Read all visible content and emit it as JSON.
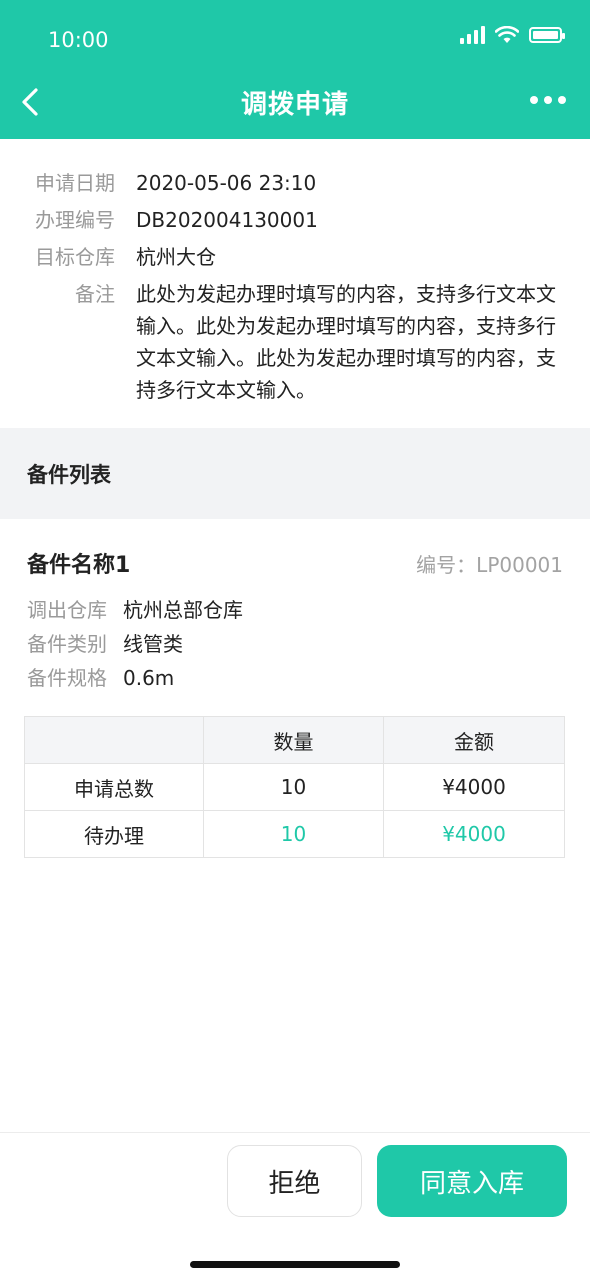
{
  "status_bar": {
    "time": "10:00"
  },
  "nav": {
    "title": "调拨申请"
  },
  "info": [
    {
      "label": "申请日期",
      "value": "2020-05-06 23:10"
    },
    {
      "label": "办理编号",
      "value": "DB202004130001"
    },
    {
      "label": "目标仓库",
      "value": "杭州大仓"
    },
    {
      "label": "备注",
      "value": "此处为发起办理时填写的内容，支持多行文本文输入。此处为发起办理时填写的内容，支持多行文本文输入。此处为发起办理时填写的内容，支持多行文本文输入。"
    }
  ],
  "section": {
    "title": "备件列表"
  },
  "part": {
    "name": "备件名称1",
    "code": "编号：LP00001",
    "rows": [
      {
        "label": "调出仓库",
        "value": "杭州总部仓库"
      },
      {
        "label": "备件类别",
        "value": "线管类"
      },
      {
        "label": "备件规格",
        "value": "0.6m"
      }
    ]
  },
  "table": {
    "headers": [
      "",
      "数量",
      "金额"
    ],
    "rows": [
      {
        "name": "申请总数",
        "qty": "10",
        "amount": "¥4000"
      },
      {
        "name": "待办理",
        "qty": "10",
        "amount": "¥4000"
      }
    ]
  },
  "actions": {
    "reject": "拒绝",
    "accept": "同意入库"
  },
  "colors": {
    "accent": "#1fc8a8"
  }
}
